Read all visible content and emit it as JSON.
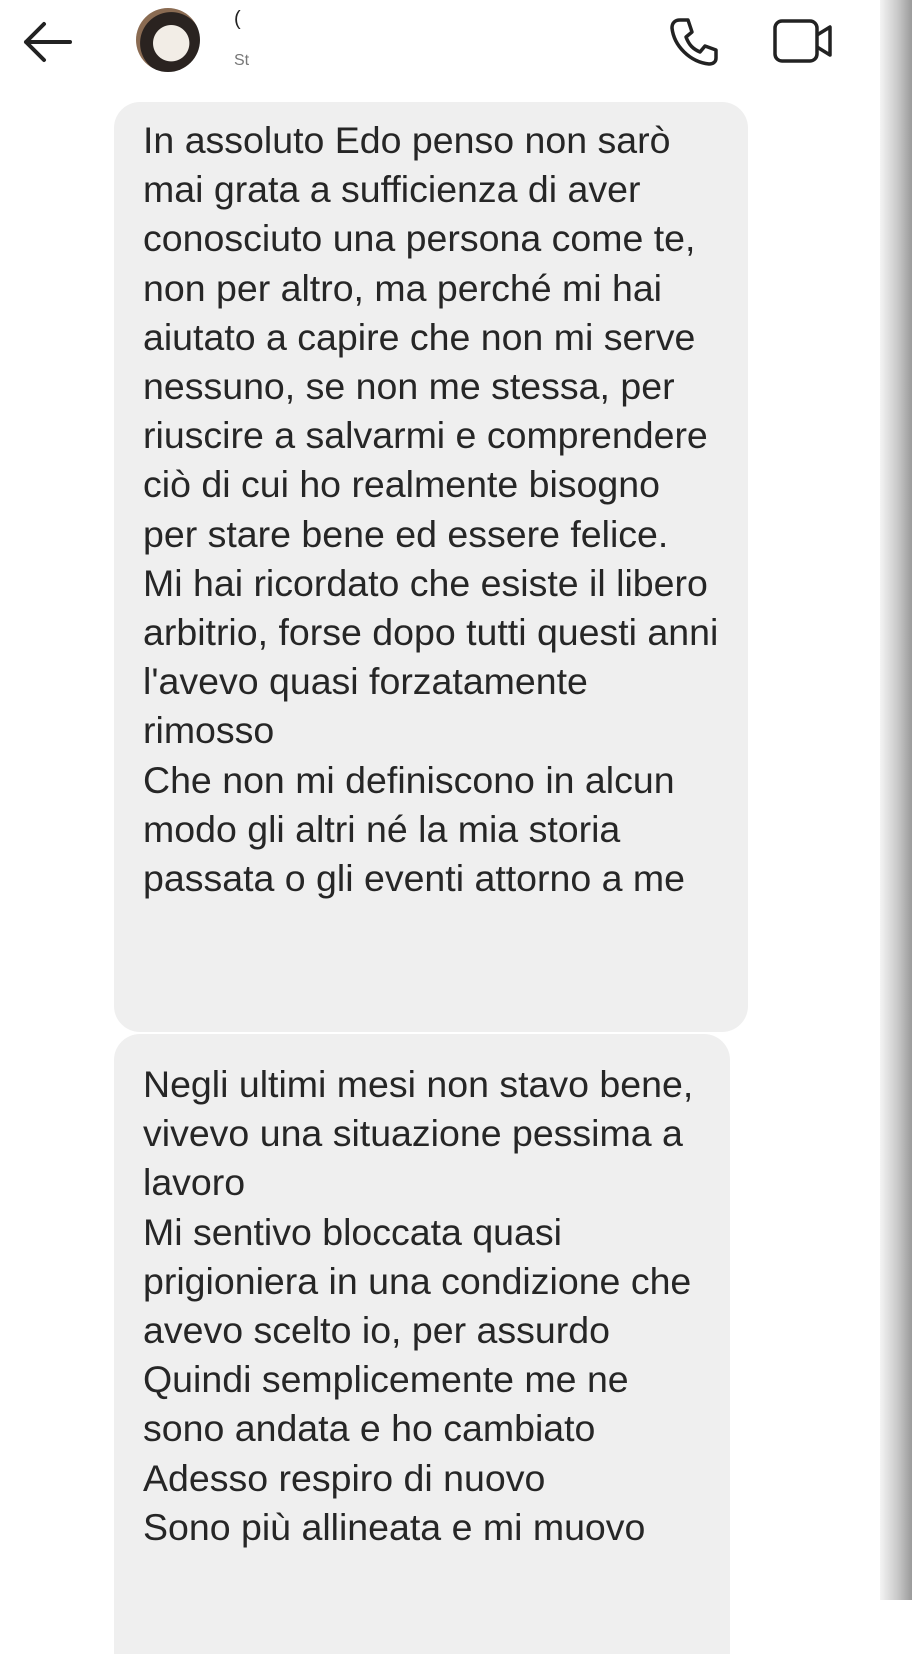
{
  "header": {
    "contact_name": "(",
    "contact_subtitle": "St",
    "icons": {
      "back": "arrow-left-icon",
      "phone": "phone-icon",
      "video": "video-camera-icon"
    }
  },
  "messages": [
    {
      "text": "In assoluto Edo penso non sarò mai grata a sufficienza di aver conosciuto una persona come te, non per altro, ma perché mi hai aiutato a capire che non mi serve nessuno, se non me stessa, per riuscire a salvarmi e comprendere ciò di cui ho realmente bisogno per stare bene ed essere felice.\nMi hai ricordato che esiste il libero arbitrio, forse dopo tutti questi anni l'avevo quasi forzatamente rimosso\nChe non mi definiscono in alcun modo gli altri né la mia storia passata o gli eventi attorno a me"
    },
    {
      "text": "Negli ultimi mesi non stavo bene, vivevo una situazione pessima a lavoro\nMi sentivo bloccata quasi prigioniera in una condizione che avevo scelto io, per assurdo\nQuindi semplicemente me ne sono andata e ho cambiato\nAdesso respiro di nuovo\nSono più allineata e mi muovo"
    }
  ],
  "colors": {
    "bubble": "#efefef",
    "text": "#262626",
    "icon": "#222222"
  }
}
